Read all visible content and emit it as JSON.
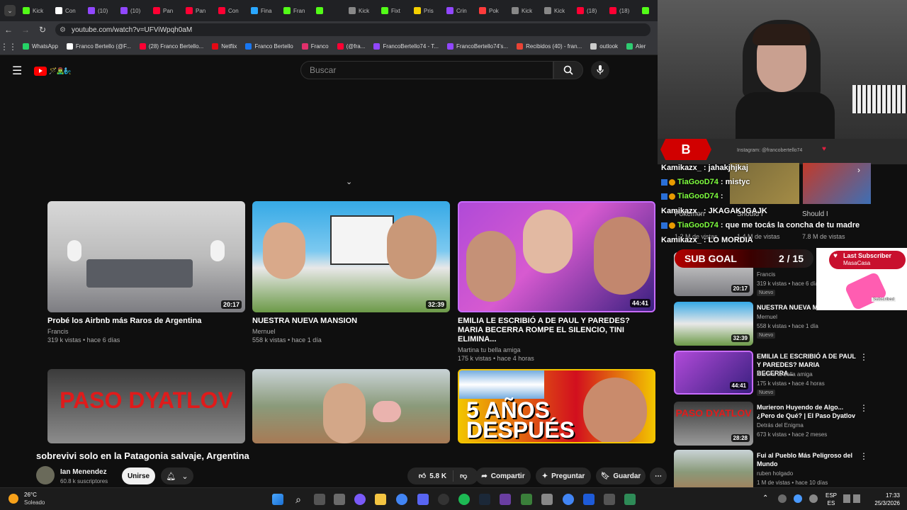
{
  "browser": {
    "tabs": [
      {
        "label": "Kick",
        "color": "#53fc18"
      },
      {
        "label": "Con",
        "color": "#ffffff"
      },
      {
        "label": "(10)",
        "color": "#9147ff"
      },
      {
        "label": "(10)",
        "color": "#9147ff"
      },
      {
        "label": "Pan",
        "color": "#ff0033"
      },
      {
        "label": "Pan",
        "color": "#ff0033"
      },
      {
        "label": "Con",
        "color": "#ff0033"
      },
      {
        "label": "Fina",
        "color": "#2aa7ff"
      },
      {
        "label": "Fran",
        "color": "#53fc18"
      },
      {
        "label": "",
        "color": "#53fc18"
      },
      {
        "label": "Kick",
        "color": "#888888"
      },
      {
        "label": "Fixt",
        "color": "#53fc18"
      },
      {
        "label": "Pris",
        "color": "#f5d000"
      },
      {
        "label": "Crin",
        "color": "#9147ff"
      },
      {
        "label": "Pok",
        "color": "#ff3b3b"
      },
      {
        "label": "Kick",
        "color": "#888888"
      },
      {
        "label": "Kick",
        "color": "#888888"
      },
      {
        "label": "(18)",
        "color": "#ff0033"
      },
      {
        "label": "(18)",
        "color": "#ff0033"
      },
      {
        "label": "",
        "color": "#53fc18"
      }
    ],
    "url": "youtube.com/watch?v=UFViWpqh0aM",
    "bookmarks": [
      {
        "label": "WhatsApp",
        "color": "#25d366"
      },
      {
        "label": "Franco Bertello (@F...",
        "color": "#ffffff"
      },
      {
        "label": "(28) Franco Bertello...",
        "color": "#ff0033"
      },
      {
        "label": "Netflix",
        "color": "#e50914"
      },
      {
        "label": "Franco Bertello",
        "color": "#1877f2"
      },
      {
        "label": "Franco",
        "color": "#e1306c"
      },
      {
        "label": "(@fra...",
        "color": "#ff0033"
      },
      {
        "label": "FrancoBertello74 - T...",
        "color": "#9147ff"
      },
      {
        "label": "FrancoBertello74's...",
        "color": "#9147ff"
      },
      {
        "label": "Recibidos (40) - fran...",
        "color": "#ea4335"
      },
      {
        "label": "outlook",
        "color": "#cccccc"
      },
      {
        "label": "Aler",
        "color": "#2ecc71"
      }
    ]
  },
  "youtube": {
    "search_placeholder": "Buscar",
    "logo_emojis": "🪄🧟‍♂️🧞‍♂️",
    "grid": [
      {
        "title": "Probé los Airbnb más Raros de Argentina",
        "channel": "Francis",
        "meta": "319 k vistas • hace 6 días",
        "duration": "20:17"
      },
      {
        "title": "NUESTRA NUEVA MANSION",
        "channel": "Mernuel",
        "meta": "558 k vistas • hace 1 día",
        "duration": "32:39"
      },
      {
        "title": "EMILIA LE ESCRIBIÓ A DE PAUL Y PAREDES? MARIA BECERRA ROMPE EL SILENCIO, TINI ELIMINA...",
        "channel": "Martina tu bella amiga",
        "meta": "175 k vistas • hace 4 horas",
        "duration": "44:41"
      }
    ],
    "grid2": [
      {
        "text": "PASO DYATLOV"
      },
      {
        "text": ""
      },
      {
        "text": "5 AÑOS DESPUÉS"
      }
    ],
    "video_title": "sobrevivi solo en la Patagonia salvaje, Argentina",
    "channel": {
      "name": "Ian Menendez",
      "subs": "60.8 k suscriptores",
      "join": "Unirse"
    },
    "actions": {
      "likes": "5.8 K",
      "share": "Compartir",
      "ask": "Preguntar",
      "save": "Guardar"
    },
    "sidebar": [
      {
        "title": "",
        "channel": "Francis",
        "meta": "319 k vistas • hace 6 días",
        "badge": "Nuevo",
        "duration": "20:17"
      },
      {
        "title": "NUESTRA NUEVA M",
        "channel": "Mernuel",
        "meta": "558 k vistas • hace 1 día",
        "badge": "Nuevo",
        "duration": "32:39"
      },
      {
        "title": "EMILIA LE ESCRIBIÓ A DE PAUL Y PAREDES? MARIA BECERRA...",
        "channel": "Martina tu bella amiga",
        "meta": "175 k vistas • hace 4 horas",
        "badge": "Nuevo",
        "duration": "44:41"
      },
      {
        "title": "Murieron Huyendo de Algo... ¿Pero de Qué? | El Paso Dyatlov",
        "channel": "Detrás del Enigma",
        "meta": "673 k vistas • hace 2 meses",
        "badge": "",
        "duration": "28:28"
      },
      {
        "title": "Fui al Pueblo Más Peligroso del Mundo",
        "channel": "ruben holgado",
        "meta": "1 M de vistas • hace 10 días",
        "badge": "",
        "duration": ""
      }
    ],
    "shorts_behind": {
      "titles": [
        "Pokemon",
        "Should I",
        "Should I"
      ],
      "views": [
        "1.2 M de vistas",
        "1.4 M de vistas",
        "7.8 M de vistas"
      ]
    }
  },
  "stream_overlay": {
    "instagram": "Instagram: @francobertello74",
    "chat": [
      {
        "user": "Kamikazx_",
        "msg": "jahakjhjkaj",
        "sub": false
      },
      {
        "user": "TiaGooD74",
        "msg": "mistyc",
        "sub": true
      },
      {
        "user": "TiaGooD74",
        "msg": "",
        "sub": true
      },
      {
        "user": "Kamikazx_",
        "msg": "JKAGAKJGAJK",
        "sub": false
      },
      {
        "user": "TiaGooD74",
        "msg": "que me tocás la concha de tu madre",
        "sub": true
      },
      {
        "user": "Kamikazx_",
        "msg": "LO MORDIA",
        "sub": false
      }
    ],
    "sub_goal": {
      "label": "SUB GOAL",
      "progress": "2 / 15",
      "current": 2,
      "target": 15
    },
    "last_subscriber": {
      "label": "Last Subscriber",
      "name": "MasaCasa",
      "status": "Subscribed"
    }
  },
  "taskbar": {
    "weather": {
      "temp": "26°C",
      "desc": "Soleado"
    },
    "lang": {
      "line1": "ESP",
      "line2": "ES"
    },
    "clock": {
      "time": "17:33",
      "date": "25/3/2026"
    }
  }
}
